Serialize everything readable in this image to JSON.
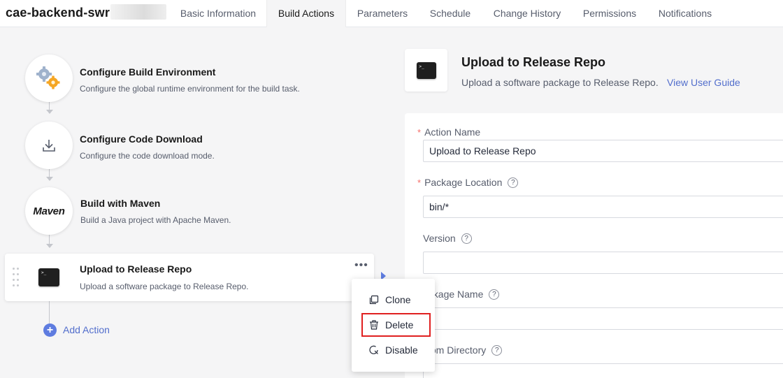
{
  "job": {
    "title": "cae-backend-swr"
  },
  "tabs": [
    {
      "label": "Basic Information",
      "active": false
    },
    {
      "label": "Build Actions",
      "active": true
    },
    {
      "label": "Parameters",
      "active": false
    },
    {
      "label": "Schedule",
      "active": false
    },
    {
      "label": "Change History",
      "active": false
    },
    {
      "label": "Permissions",
      "active": false
    },
    {
      "label": "Notifications",
      "active": false
    }
  ],
  "steps": [
    {
      "title": "Configure Build Environment",
      "desc": "Configure the global runtime environment for the build task.",
      "icon": "gears-icon"
    },
    {
      "title": "Configure Code Download",
      "desc": "Configure the code download mode.",
      "icon": "download-icon"
    },
    {
      "title": "Build with Maven",
      "desc": "Build a Java project with Apache Maven.",
      "icon": "maven-logo",
      "logo_text": "Maven"
    },
    {
      "title": "Upload to Release Repo",
      "desc": "Upload a software package to Release Repo.",
      "icon": "terminal-icon",
      "selected": true
    }
  ],
  "add_action": {
    "label": "Add Action"
  },
  "terminal_glyph": ">_",
  "detail": {
    "title": "Upload to Release Repo",
    "desc": "Upload a software package to Release Repo.",
    "link": "View User Guide",
    "fields": [
      {
        "label": "Action Name",
        "required": true,
        "help": false,
        "value": "Upload to Release Repo"
      },
      {
        "label": "Package Location",
        "required": true,
        "help": true,
        "value": "bin/*"
      },
      {
        "label": "Version",
        "required": false,
        "help": true,
        "value": ""
      },
      {
        "label": "ackage Name",
        "required": false,
        "help": true,
        "value": ""
      },
      {
        "label": "stom Directory",
        "required": false,
        "help": true,
        "value": ""
      }
    ]
  },
  "context_menu": {
    "items": [
      {
        "label": "Clone",
        "icon": "clone-icon"
      },
      {
        "label": "Delete",
        "icon": "trash-icon",
        "highlighted": true
      },
      {
        "label": "Disable",
        "icon": "disable-icon"
      }
    ]
  },
  "colors": {
    "accent": "#5e7ce0",
    "link": "#526ecc",
    "required": "#f66f6a",
    "highlight_box": "#e02020"
  }
}
